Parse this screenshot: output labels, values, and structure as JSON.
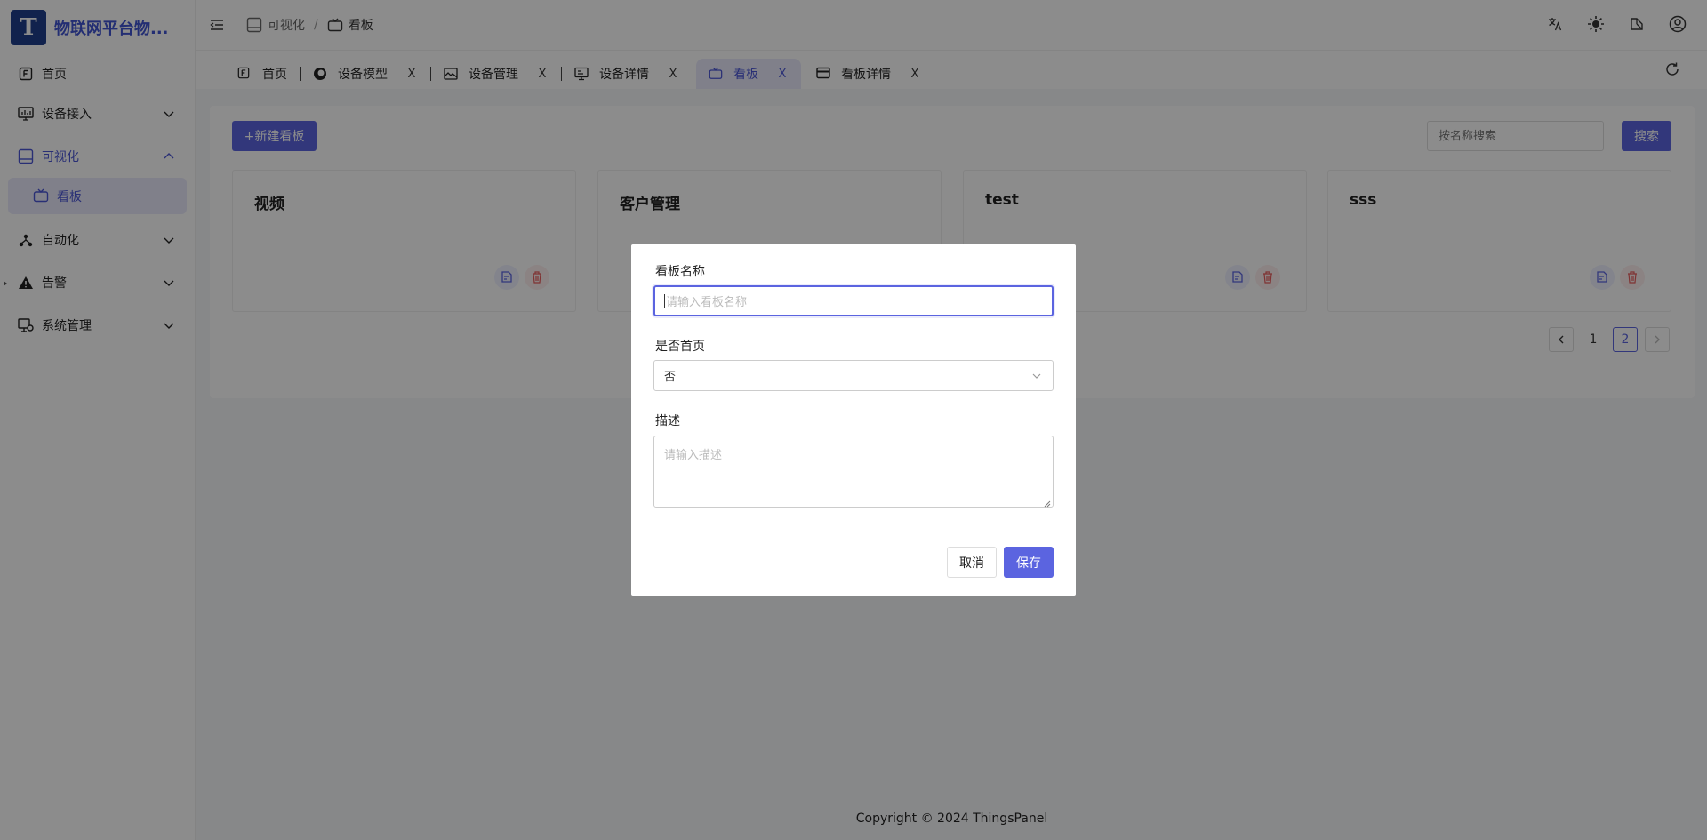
{
  "app": {
    "logo_letter": "T",
    "logo_text": "物联网平台物..."
  },
  "sidebar": {
    "items": [
      {
        "label": "首页",
        "icon": "home-icon"
      },
      {
        "label": "设备接入",
        "icon": "monitor-icon"
      },
      {
        "label": "可视化",
        "icon": "tv-icon"
      },
      {
        "label": "看板",
        "icon": "board-icon"
      },
      {
        "label": "自动化",
        "icon": "flow-icon"
      },
      {
        "label": "告警",
        "icon": "warning-icon"
      },
      {
        "label": "系统管理",
        "icon": "settings-icon"
      }
    ]
  },
  "breadcrumb": {
    "items": [
      "可视化",
      "看板"
    ],
    "separator": "/"
  },
  "tabs": [
    {
      "label": "首页"
    },
    {
      "label": "设备模型"
    },
    {
      "label": "设备管理"
    },
    {
      "label": "设备详情"
    },
    {
      "label": "看板"
    },
    {
      "label": "看板详情"
    }
  ],
  "tab_close_glyph": "X",
  "toolbar": {
    "new_label": "+新建看板",
    "search_placeholder": "按名称搜索",
    "search_label": "搜索"
  },
  "cards": [
    {
      "title": "视频"
    },
    {
      "title": "客户管理"
    },
    {
      "title": "test"
    },
    {
      "title": "sss"
    }
  ],
  "pagination": {
    "pages": [
      "1",
      "2"
    ],
    "current": "2"
  },
  "footer": {
    "copyright": "Copyright © 2024 ThingsPanel"
  },
  "modal": {
    "name_label": "看板名称",
    "name_placeholder": "请输入看板名称",
    "home_label": "是否首页",
    "home_value": "否",
    "desc_label": "描述",
    "desc_placeholder": "请输入描述",
    "cancel_label": "取消",
    "save_label": "保存"
  },
  "colors": {
    "primary": "#5b64e0",
    "active_bg": "#e9eafc",
    "logo_bg": "#1f3e8c",
    "danger": "#e85d5d"
  }
}
